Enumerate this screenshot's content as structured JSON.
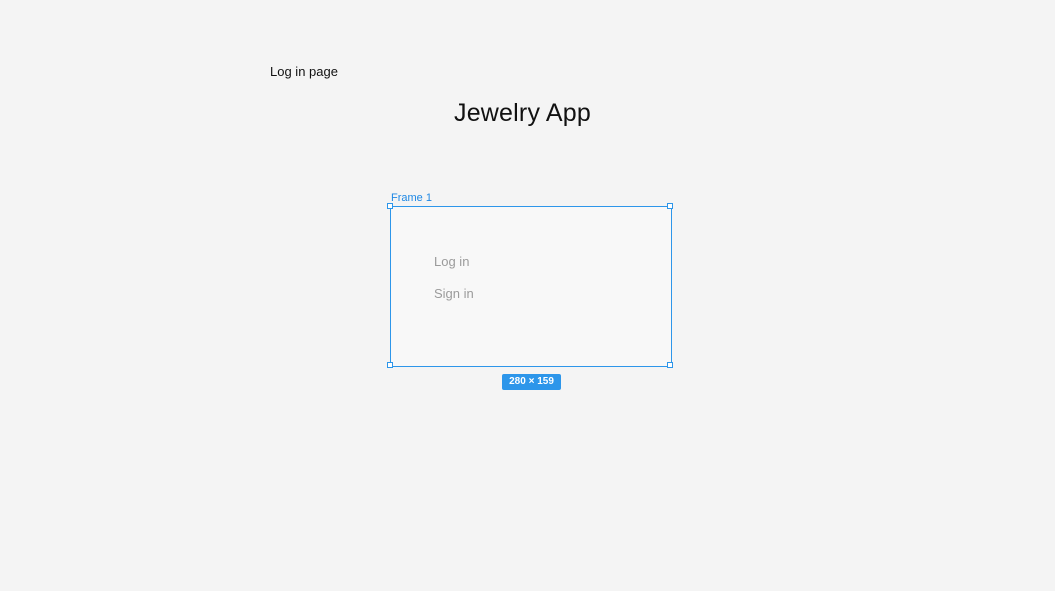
{
  "canvas": {
    "page_label": "Log in page",
    "title": "Jewelry App"
  },
  "frame": {
    "name": "Frame 1",
    "items": [
      {
        "label": "Log in"
      },
      {
        "label": "Sign in"
      }
    ],
    "size_badge": "280 × 159"
  },
  "colors": {
    "canvas_background": "#f4f4f4",
    "selection_accent": "#2d96ea",
    "frame_fill": "#f8f8f8",
    "placeholder_text": "#9b9b9b"
  }
}
